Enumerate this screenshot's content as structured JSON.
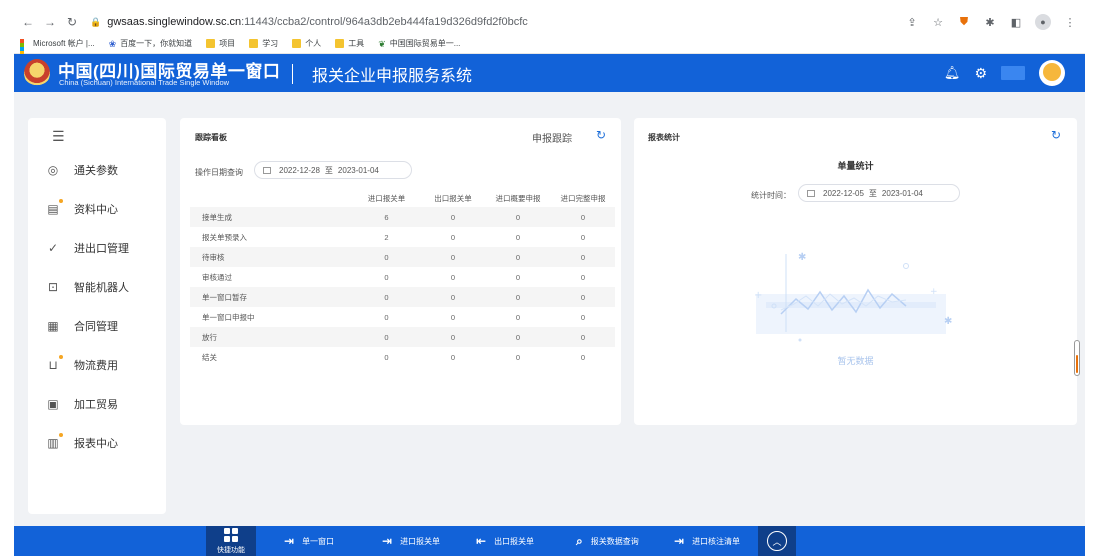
{
  "browser": {
    "url_host": "gwsaas.singlewindow.sc.cn",
    "url_path": ":11443/ccba2/control/964a3db2eb444fa19d326d9fd2f0bcfc",
    "bookmarks": [
      "Microsoft 帐户 |...",
      "百度一下，你就知道",
      "项目",
      "学习",
      "个人",
      "工具",
      "中国国际贸易单一..."
    ]
  },
  "header": {
    "brand_cn": "中国(四川)国际贸易单一窗口",
    "brand_en": "China (Sichuan) International Trade Single Window",
    "system_title": "报关企业申报服务系统"
  },
  "sidebar": {
    "items": [
      {
        "label": "通关参数",
        "icon": "globe-icon"
      },
      {
        "label": "资料中心",
        "icon": "document-icon"
      },
      {
        "label": "进出口管理",
        "icon": "check-circle-icon"
      },
      {
        "label": "智能机器人",
        "icon": "robot-icon"
      },
      {
        "label": "合同管理",
        "icon": "contract-icon"
      },
      {
        "label": "物流费用",
        "icon": "cart-icon"
      },
      {
        "label": "加工贸易",
        "icon": "processing-icon"
      },
      {
        "label": "报表中心",
        "icon": "report-icon"
      }
    ]
  },
  "tracking": {
    "title": "跟踪看板",
    "link": "申报跟踪",
    "date_label": "操作日期查询",
    "date_start": "2022-12-28",
    "date_sep": "至",
    "date_end": "2023-01-04",
    "columns": [
      "进口报关单",
      "出口报关单",
      "进口概要申报",
      "进口完整申报"
    ],
    "rows": [
      {
        "label": "接单生成",
        "values": [
          "6",
          "0",
          "0",
          "0"
        ]
      },
      {
        "label": "报关单预录入",
        "values": [
          "2",
          "0",
          "0",
          "0"
        ]
      },
      {
        "label": "待审核",
        "values": [
          "0",
          "0",
          "0",
          "0"
        ]
      },
      {
        "label": "审核通过",
        "values": [
          "0",
          "0",
          "0",
          "0"
        ]
      },
      {
        "label": "单一窗口暂存",
        "values": [
          "0",
          "0",
          "0",
          "0"
        ]
      },
      {
        "label": "单一窗口申报中",
        "values": [
          "0",
          "0",
          "0",
          "0"
        ]
      },
      {
        "label": "放行",
        "values": [
          "0",
          "0",
          "0",
          "0"
        ]
      },
      {
        "label": "结关",
        "values": [
          "0",
          "0",
          "0",
          "0"
        ]
      }
    ]
  },
  "stats": {
    "title": "报表统计",
    "subtitle": "单量统计",
    "date_label": "统计时间：",
    "date_start": "2022-12-05",
    "date_sep": "至",
    "date_end": "2023-01-04",
    "empty_text": "暂无数据"
  },
  "dock": {
    "quick_label": "快捷功能",
    "items": [
      "单一窗口",
      "进口报关单",
      "出口报关单",
      "报关数据查询",
      "进口核注清单"
    ]
  },
  "colors": {
    "brand_blue": "#1262d8",
    "accent_blue": "#1e6fd9",
    "dock_dark": "#0f3f8a"
  }
}
